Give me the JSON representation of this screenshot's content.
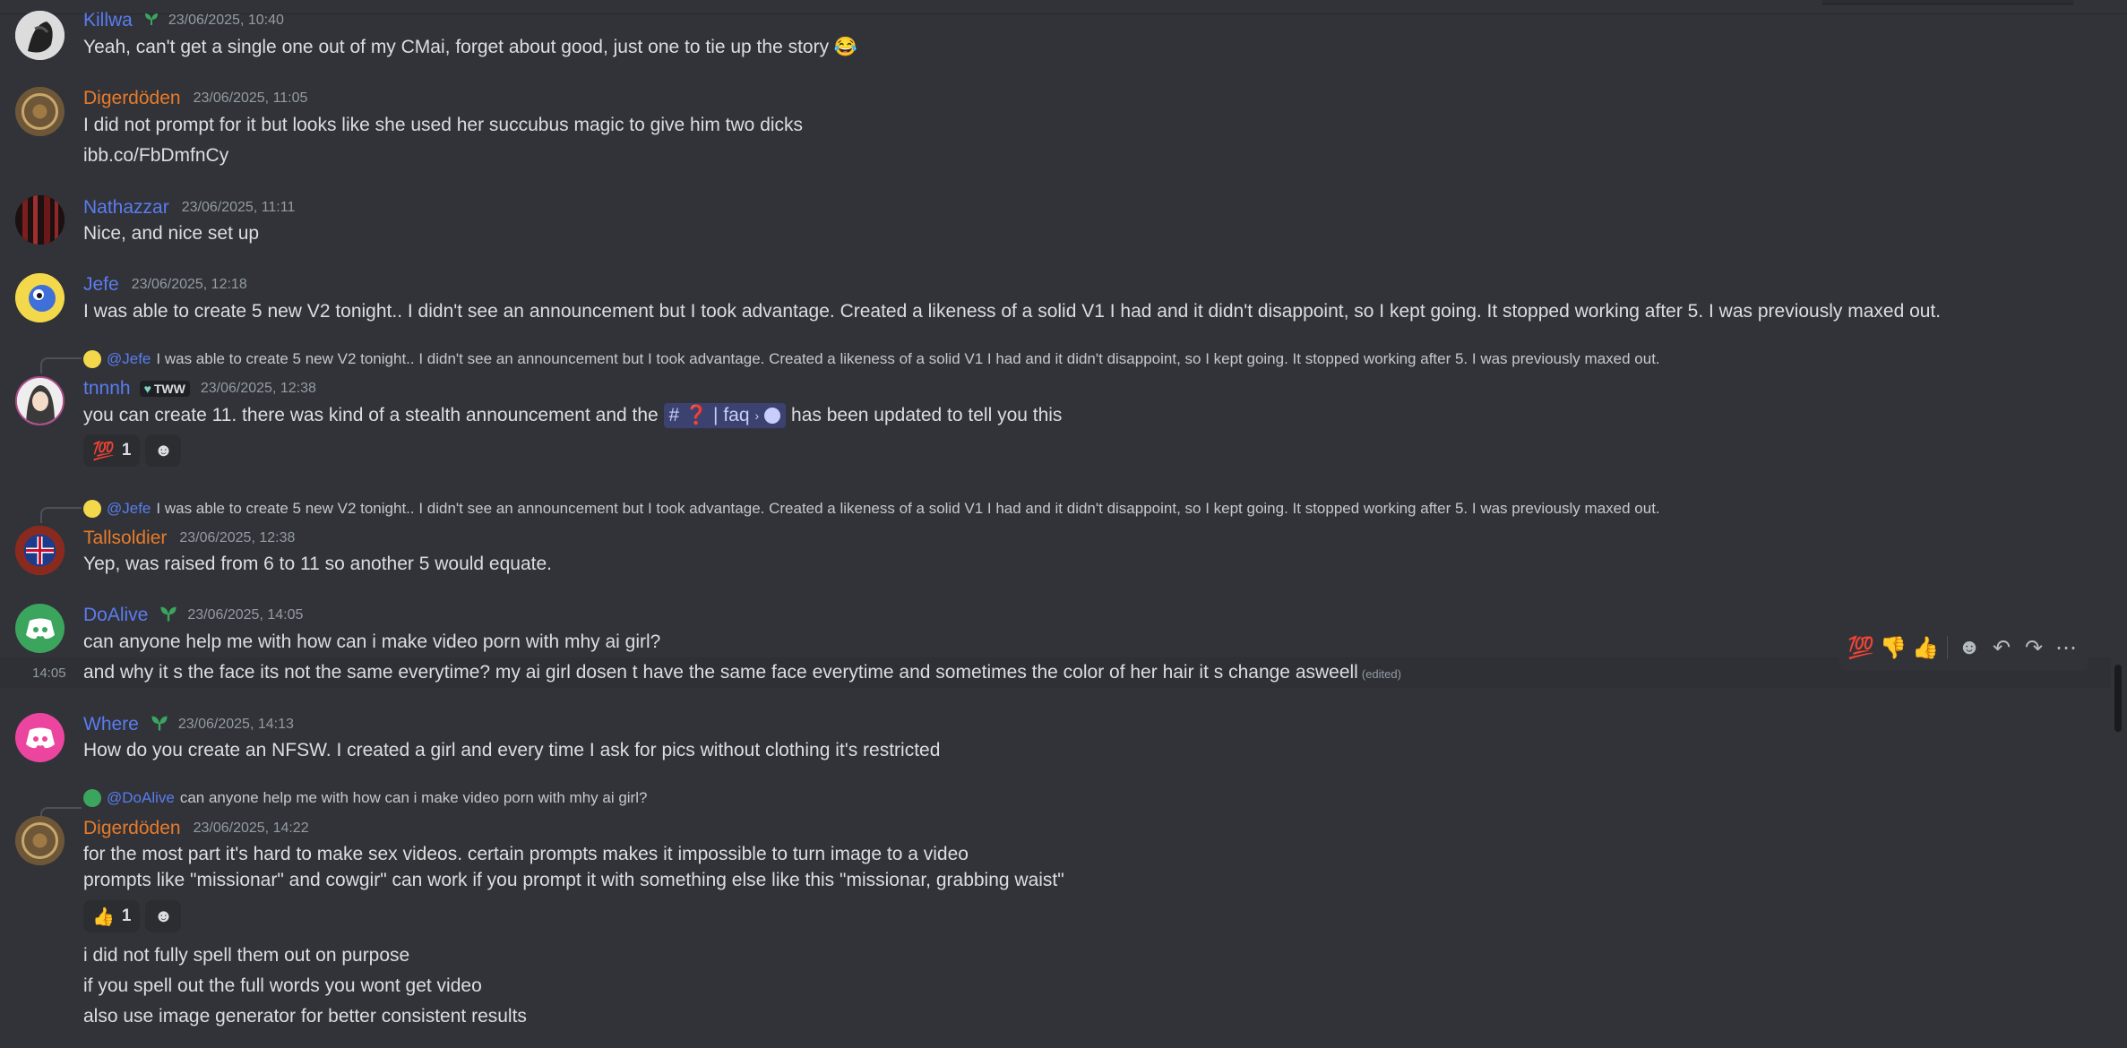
{
  "messages": [
    {
      "user": "Killwa",
      "time": "23/06/2025, 10:40",
      "lines": [
        "Yeah, can't get a single one out of my CMai, forget about good, just one to tie up the story 😂"
      ]
    },
    {
      "user": "Digerdöden",
      "time": "23/06/2025, 11:05",
      "lines": [
        "I did not prompt for it but looks like she used her succubus magic to give him two dicks",
        "ibb.co/FbDmfnCy"
      ]
    },
    {
      "user": "Nathazzar",
      "time": "23/06/2025, 11:11",
      "lines": [
        "Nice, and nice set up"
      ]
    },
    {
      "user": "Jefe",
      "time": "23/06/2025, 12:18",
      "lines": [
        "I was able to create 5 new V2 tonight.. I didn't see an announcement but I took advantage. Created a likeness of a solid V1 I had and it didn't disappoint, so I kept going. It stopped working after 5. I was previously maxed out."
      ]
    },
    {
      "user": "tnnnh",
      "tag": "TWW",
      "time": "23/06/2025, 12:38",
      "reply_at": "@Jefe",
      "reply_text": "I was able to create 5 new V2 tonight.. I didn't see an announcement but I took advantage. Created a likeness of a solid V1 I had and it didn't disappoint, so I kept going. It stopped working after 5. I was previously maxed out.",
      "line_before": "you can create 11. there was kind of a stealth announcement and the",
      "channel": "# ❓ | faq",
      "line_after": "has been updated to tell you this",
      "reaction_emoji": "💯",
      "reaction_count": "1"
    },
    {
      "user": "Tallsoldier",
      "time": "23/06/2025, 12:38",
      "reply_at": "@Jefe",
      "reply_text": "I was able to create 5 new V2 tonight.. I didn't see an announcement but I took advantage. Created a likeness of a solid V1 I had and it didn't disappoint, so I kept going. It stopped working after 5. I was previously maxed out.",
      "lines": [
        "Yep, was raised from 6 to 11 so another 5 would equate."
      ]
    },
    {
      "user": "DoAlive",
      "time": "23/06/2025, 14:05",
      "lines": [
        "can anyone help me with how can i make video porn with mhy ai girl?",
        "and why it s the face its not the same everytime? my ai girl dosen t have the same face everytime and sometimes the color of her hair it s change asweell"
      ],
      "hover_time": "14:05",
      "edited": "(edited)"
    },
    {
      "user": "Where",
      "time": "23/06/2025, 14:13",
      "lines": [
        "How do you create an NFSW. I created a girl and every time I ask for pics without clothing it's restricted"
      ]
    },
    {
      "user": "Digerdöden",
      "time": "23/06/2025, 14:22",
      "reply_at": "@DoAlive",
      "reply_text": "can anyone help me with how can i make video porn with mhy ai girl?",
      "lines": [
        "for the most part it's hard to make sex videos. certain prompts makes it impossible to turn image to a video",
        "prompts like \"missionar\" and cowgir\" can work if you prompt it with something else like this \"missionar, grabbing waist\""
      ],
      "reaction_emoji": "👍",
      "reaction_count": "1",
      "lines_after": [
        "i did not fully spell them out on purpose",
        "if you spell out the full words you wont get video",
        "also use image generator for better consistent results"
      ]
    }
  ],
  "toolbar": {
    "emoji1": "💯",
    "emoji2": "👎",
    "emoji3": "👍",
    "add_reaction": "☻",
    "reply": "↶",
    "forward": "↷",
    "more": "⋯"
  },
  "colors": {
    "bg": "#313338",
    "blue_name": "#5a7cf0",
    "orange_name": "#e87b2a",
    "timestamp": "#949ba4"
  }
}
